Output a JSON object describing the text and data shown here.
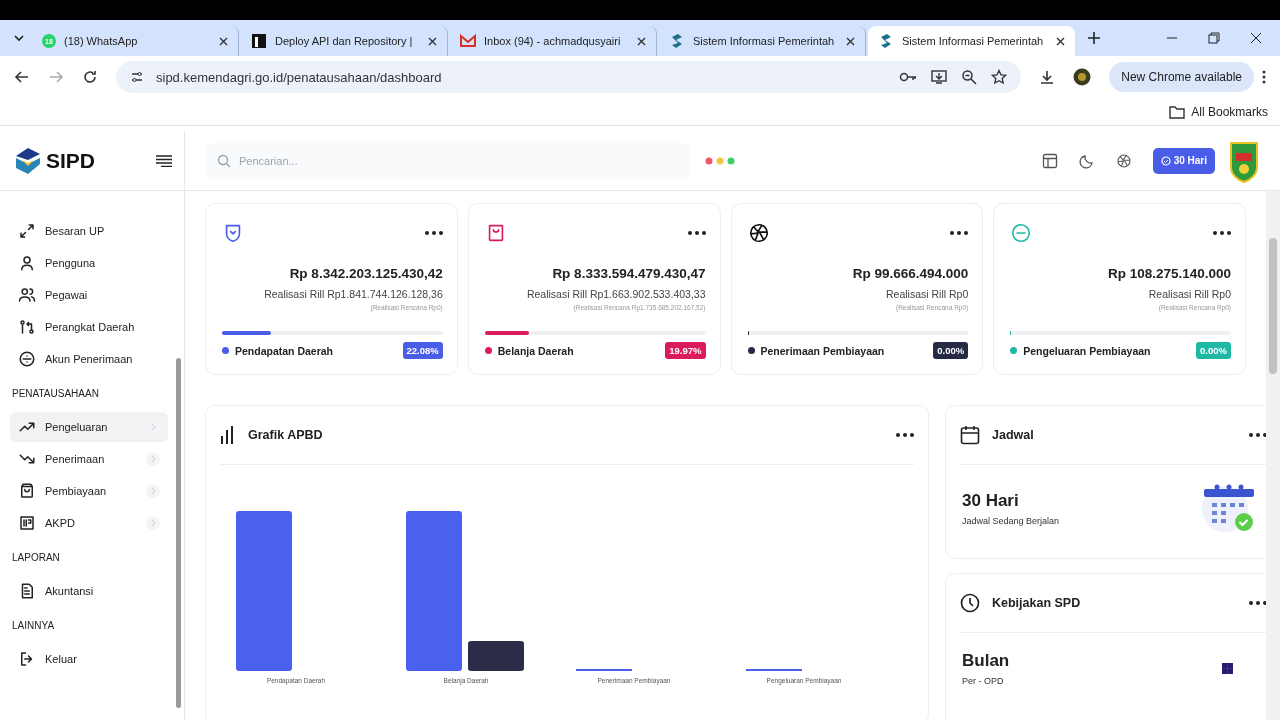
{
  "browser": {
    "tabs": [
      {
        "title": "(18) WhatsApp",
        "selected": false
      },
      {
        "title": "Deploy API dan Repository |",
        "selected": false
      },
      {
        "title": "Inbox (94) - achmadqusyairi",
        "selected": false
      },
      {
        "title": "Sistem Informasi Pemerintah",
        "selected": false
      },
      {
        "title": "Sistem Informasi Pemerintah",
        "selected": true
      }
    ],
    "badge": "18",
    "address": "sipd.kemendagri.go.id/penatausahaan/dashboard",
    "update_button": "New Chrome available",
    "bookmarks": "All Bookmarks"
  },
  "sidebar": {
    "logo": "SIPD",
    "sections": [
      {
        "items": [
          {
            "label": "Besaran UP",
            "hovered": false,
            "has_submenu": false
          },
          {
            "label": "Pengguna",
            "hovered": false,
            "has_submenu": false
          },
          {
            "label": "Pegawai",
            "hovered": false,
            "has_submenu": false
          },
          {
            "label": "Perangkat Daerah",
            "hovered": false,
            "has_submenu": false
          },
          {
            "label": "Akun Penerimaan",
            "hovered": false,
            "has_submenu": false
          }
        ]
      },
      {
        "heading": "PENATAUSAHAAN",
        "items": [
          {
            "label": "Pengeluaran",
            "hovered": true,
            "has_submenu": true
          },
          {
            "label": "Penerimaan",
            "hovered": false,
            "has_submenu": true
          },
          {
            "label": "Pembiayaan",
            "hovered": false,
            "has_submenu": true
          },
          {
            "label": "AKPD",
            "hovered": false,
            "has_submenu": true
          }
        ]
      },
      {
        "heading": "LAPORAN",
        "items": [
          {
            "label": "Akuntansi",
            "hovered": false,
            "has_submenu": false
          }
        ]
      },
      {
        "heading": "LAINNYA",
        "items": [
          {
            "label": "Keluar",
            "hovered": false,
            "has_submenu": false
          }
        ]
      }
    ]
  },
  "header": {
    "search": {
      "placeholder": "Pencarian..."
    },
    "schedule_button": "30 Hari"
  },
  "stat_cards": [
    {
      "amount": "Rp 8.342.203.125.430,42",
      "realisasi": "Realisasi Rill Rp1.841.744.126.128,36",
      "rencana": "(Realisasi Rencana Rp0)",
      "level": 0.2208,
      "label": "Pendapatan Daerah",
      "percent": "22.08%",
      "color": "#4a5de8"
    },
    {
      "amount": "Rp 8.333.594.479.430,47",
      "realisasi": "Realisasi Rill Rp1.663.902.533.403,33",
      "rencana": "(Realisasi Rencana Rp1.735.685.202.167,52)",
      "level": 0.1997,
      "label": "Belanja Daerah",
      "percent": "19.97%",
      "color": "#dc1a5e"
    },
    {
      "amount": "Rp 99.666.494.000",
      "realisasi": "Realisasi Rill Rp0",
      "rencana": "(Realisasi Rencana Rp0)",
      "level": 0,
      "label": "Penerimaan Pembiayaan",
      "percent": "0.00%",
      "color": "#262a44"
    },
    {
      "amount": "Rp 108.275.140.000",
      "realisasi": "Realisasi Rill Rp0",
      "rencana": "(Realisasi Rencana Rp0)",
      "level": 0,
      "label": "Pengeluaran Pembiayaan",
      "percent": "0.00%",
      "color": "#1fb8a5"
    }
  ],
  "chart_card": {
    "title": "Grafik APBD",
    "categories": [
      "Pendapatan Daerah",
      "Belanja Daerah",
      "Penerimaan Pembiayaan",
      "Pengeluaran Pembiayaan"
    ]
  },
  "schedule_card": {
    "title": "Jadwal",
    "value": "30 Hari",
    "caption": "Jadwal Sedang Berjalan"
  },
  "policy_card": {
    "title": "Kebijakan SPD",
    "value": "Bulan",
    "caption": "Per - OPD"
  }
}
